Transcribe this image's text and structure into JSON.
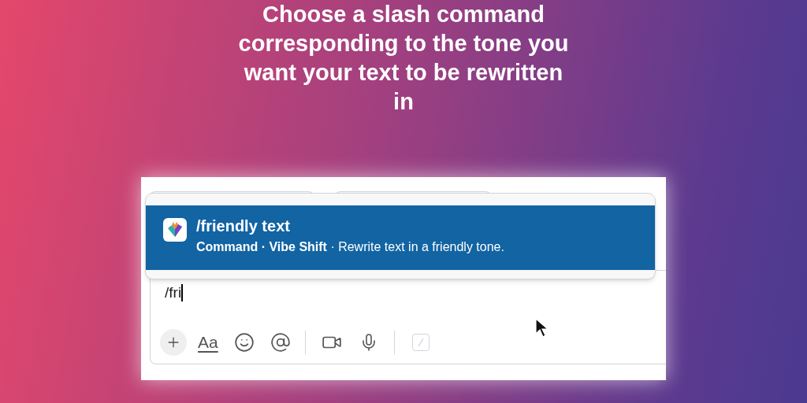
{
  "headline": "Choose a slash command corresponding to the tone you want your text to be rewritten in",
  "suggestion": {
    "command": "/friendly text",
    "meta": "**Command · Vibe Shift** · Rewrite text in a friendly tone.",
    "selected": true
  },
  "composer": {
    "value": "/fri",
    "format_label": "Aa",
    "slash_disabled": true
  }
}
